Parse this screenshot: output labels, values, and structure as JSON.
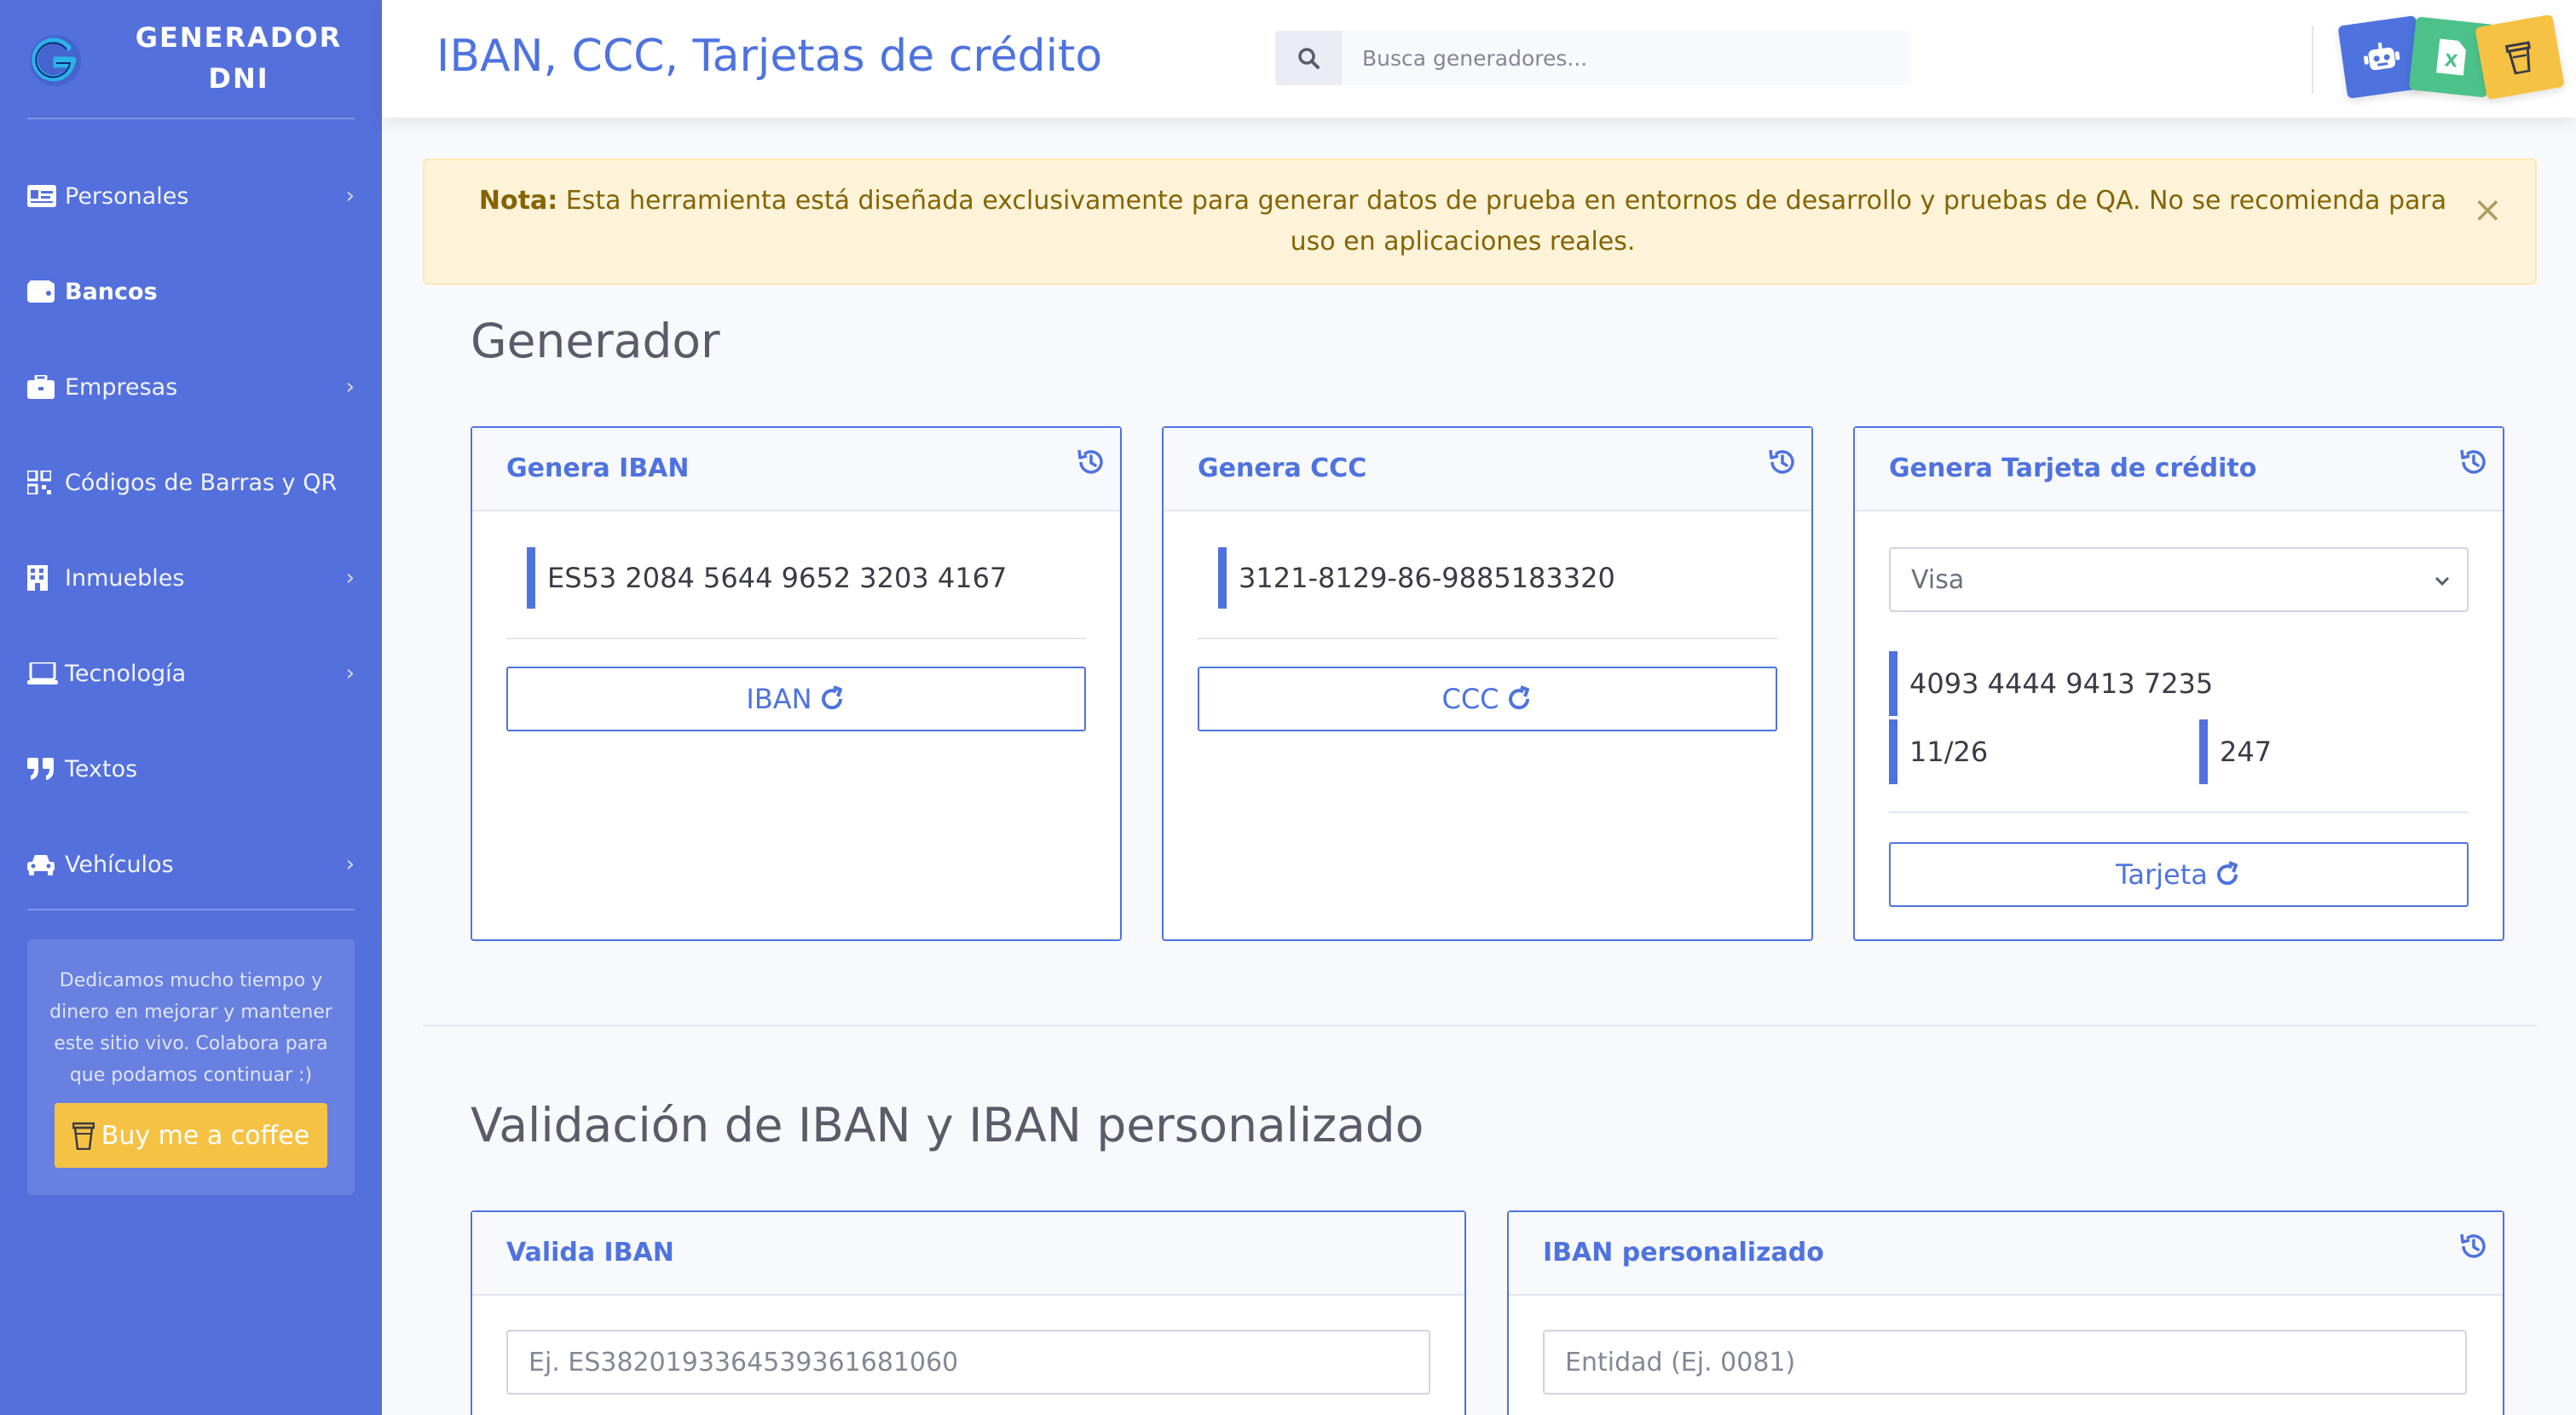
{
  "brand": {
    "line1": "GENERADOR",
    "line2": "DNI"
  },
  "sidebar": {
    "items": [
      {
        "label": "Personales",
        "icon": "id-card-icon",
        "has_chevron": true
      },
      {
        "label": "Bancos",
        "icon": "wallet-icon",
        "has_chevron": false,
        "active": true
      },
      {
        "label": "Empresas",
        "icon": "briefcase-icon",
        "has_chevron": true
      },
      {
        "label": "Códigos de Barras y QR",
        "icon": "qrcode-icon",
        "has_chevron": false
      },
      {
        "label": "Inmuebles",
        "icon": "building-icon",
        "has_chevron": true
      },
      {
        "label": "Tecnología",
        "icon": "laptop-icon",
        "has_chevron": true
      },
      {
        "label": "Textos",
        "icon": "quote-icon",
        "has_chevron": false
      },
      {
        "label": "Vehículos",
        "icon": "car-icon",
        "has_chevron": true
      }
    ],
    "donate": {
      "text": "Dedicamos mucho tiempo y dinero en mejorar y mantener este sitio vivo. Colabora para que podamos continuar :)",
      "button_label": "Buy me a coffee"
    }
  },
  "topbar": {
    "title": "IBAN, CCC, Tarjetas de crédito",
    "search_placeholder": "Busca generadores...",
    "tiles": [
      {
        "icon": "robot-icon",
        "color": "#4e73df"
      },
      {
        "icon": "excel-icon",
        "color": "#4cc28a"
      },
      {
        "icon": "coffee-cup-icon",
        "color": "#f6c243"
      }
    ]
  },
  "alert": {
    "label": "Nota:",
    "text": "Esta herramienta está diseñada exclusivamente para generar datos de prueba en entornos de desarrollo y pruebas de QA. No se recomienda para uso en aplicaciones reales.",
    "close": "×"
  },
  "sections": {
    "generator_title": "Generador",
    "validation_title": "Validación de IBAN y IBAN personalizado"
  },
  "cards": {
    "iban": {
      "title": "Genera IBAN",
      "value": "ES53 2084 5644 9652 3203 4167",
      "button": "IBAN"
    },
    "ccc": {
      "title": "Genera CCC",
      "value": "3121-8129-86-9885183320",
      "button": "CCC"
    },
    "card": {
      "title": "Genera Tarjeta de crédito",
      "selected_type": "Visa",
      "number": "4093 4444 9413 7235",
      "expiry": "11/26",
      "cvv": "247",
      "button": "Tarjeta"
    },
    "validate": {
      "title": "Valida IBAN",
      "placeholder": "Ej. ES3820193364539361681060"
    },
    "custom": {
      "title": "IBAN personalizado",
      "placeholder": "Entidad (Ej. 0081)"
    }
  },
  "colors": {
    "primary": "#4e73df",
    "sidebar": "#5470dc",
    "alert_bg": "#fdf3d8",
    "alert_text": "#856404"
  }
}
